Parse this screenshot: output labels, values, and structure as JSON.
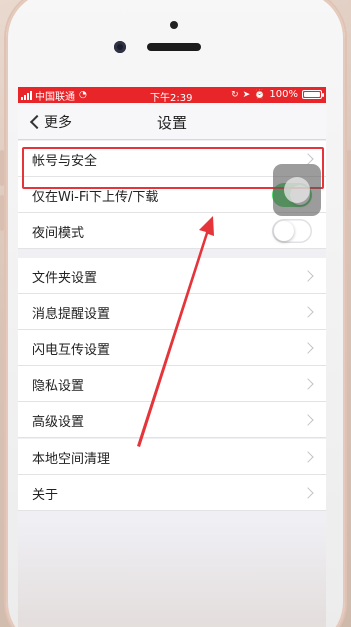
{
  "status_bar": {
    "carrier": "中国联通",
    "time": "下午2:39",
    "battery": "100%",
    "battery_level": 1.0,
    "color": "#e8262a"
  },
  "nav": {
    "back_label": "更多",
    "title": "设置"
  },
  "groups": [
    {
      "rows": [
        {
          "label": "帐号与安全",
          "control": "chevron"
        },
        {
          "label": "仅在Wi-Fi下上传/下载",
          "control": "toggle",
          "on": true
        },
        {
          "label": "夜间模式",
          "control": "toggle",
          "on": false
        }
      ]
    },
    {
      "rows": [
        {
          "label": "文件夹设置",
          "control": "chevron"
        },
        {
          "label": "消息提醒设置",
          "control": "chevron"
        },
        {
          "label": "闪电互传设置",
          "control": "chevron"
        },
        {
          "label": "隐私设置",
          "control": "chevron"
        },
        {
          "label": "高级设置",
          "control": "chevron"
        }
      ]
    },
    {
      "rows": [
        {
          "label": "本地空间清理",
          "control": "chevron"
        },
        {
          "label": "关于",
          "control": "chevron"
        }
      ]
    }
  ],
  "colors": {
    "accent_red": "#e5343a",
    "toggle_on": "#4cd964",
    "background": "#efeff4"
  },
  "icons": {
    "back": "chevron-left-icon",
    "row_arrow": "chevron-right-icon",
    "wifi": "wifi-icon",
    "alarm": "alarm-icon",
    "lock": "orientation-lock-icon"
  }
}
